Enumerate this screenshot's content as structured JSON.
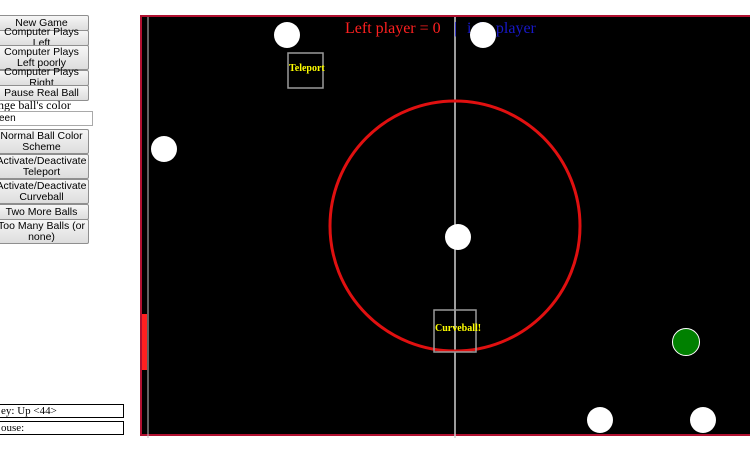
{
  "controls": {
    "buttons": [
      {
        "id": "new-game-button",
        "label": "New Game"
      },
      {
        "id": "computer-plays-left-button",
        "label": "Computer Plays Left"
      },
      {
        "id": "computer-plays-left-poorly-button",
        "label": "Computer Plays Left poorly"
      },
      {
        "id": "computer-plays-right-button",
        "label": "Computer Plays Right"
      },
      {
        "id": "pause-real-ball-button",
        "label": "Pause Real Ball"
      },
      {
        "id": "normal-ball-color-button",
        "label": "Normal Ball Color Scheme"
      },
      {
        "id": "toggle-teleport-button",
        "label": "Activate/Deactivate Teleport"
      },
      {
        "id": "toggle-curveball-button",
        "label": "Activate/Deactivate Curveball"
      },
      {
        "id": "two-more-balls-button",
        "label": "Two More Balls"
      },
      {
        "id": "too-many-balls-button",
        "label": "Too Many Balls (or none)"
      }
    ],
    "color_label": "nge ball's color",
    "color_value": "een"
  },
  "status": {
    "key_text": "ey: Up <44>",
    "mouse_text": "ouse:"
  },
  "game": {
    "score_left": "Left player = 0",
    "score_right": "ight player",
    "teleport_label": "Teleport",
    "curveball_label": "Curveball!",
    "colors": {
      "field": "#000000",
      "center_circle": "#e01010",
      "ball": "#ffffff",
      "real_ball": "#008000",
      "paddle": "#ff2020",
      "border": "#b01030"
    }
  }
}
